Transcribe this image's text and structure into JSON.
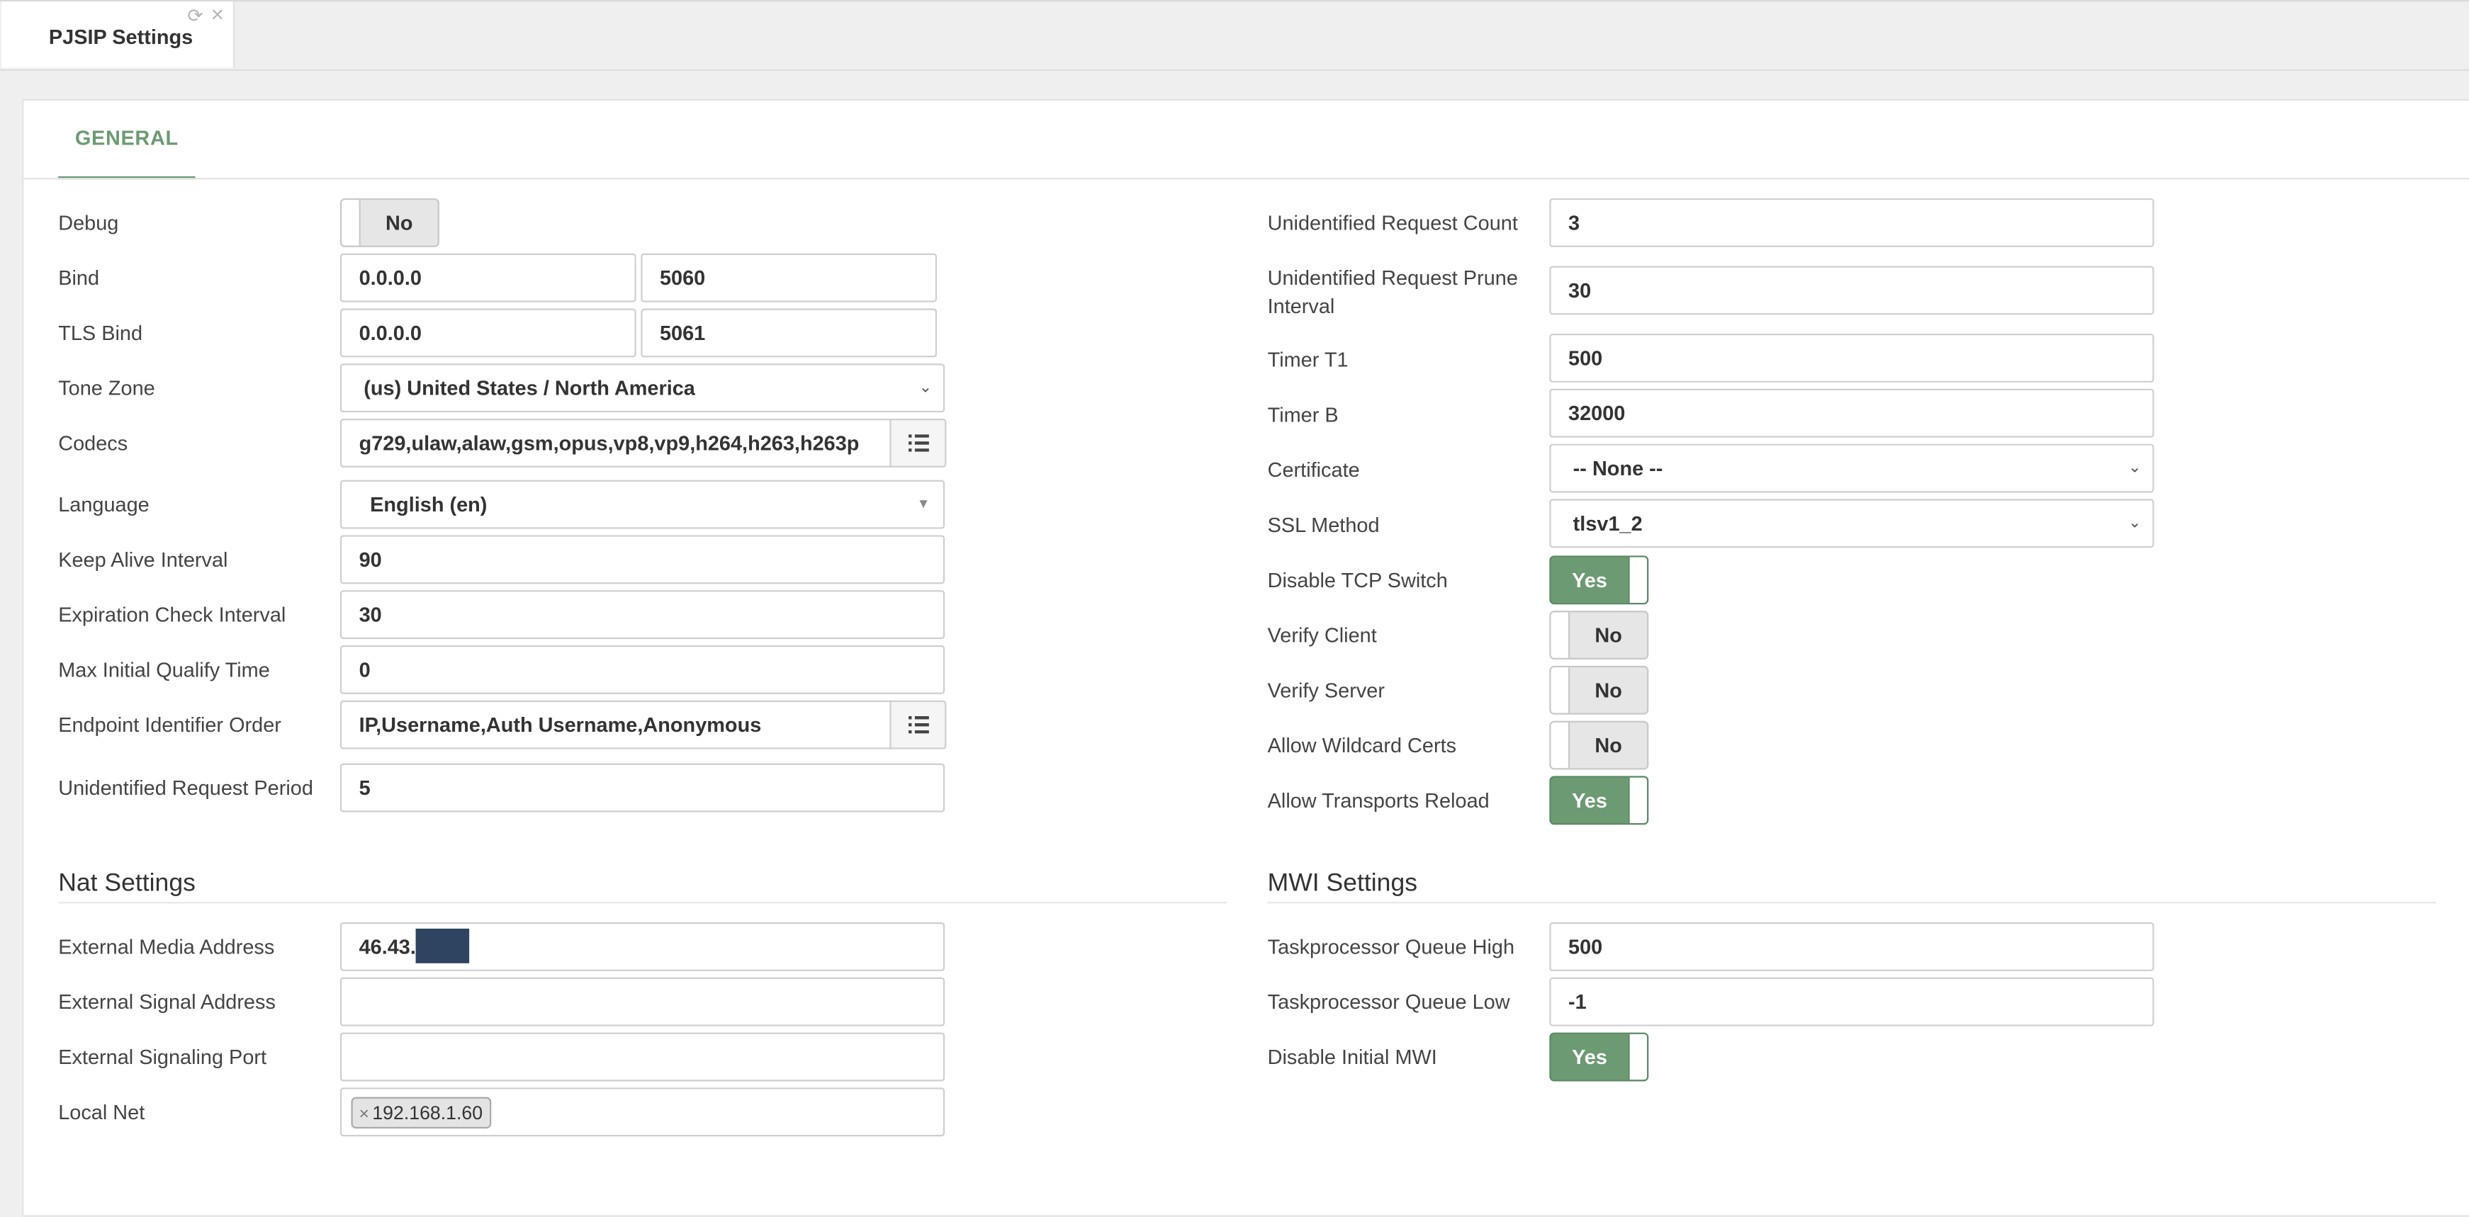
{
  "tab": {
    "title": "PJSIP Settings"
  },
  "panel_tab": "GENERAL",
  "left": {
    "debug_label": "Debug",
    "debug_value": "No",
    "bind_label": "Bind",
    "bind_ip": "0.0.0.0",
    "bind_port": "5060",
    "tls_bind_label": "TLS Bind",
    "tls_ip": "0.0.0.0",
    "tls_port": "5061",
    "tone_zone_label": "Tone Zone",
    "tone_zone_value": "(us) United States / North America",
    "codecs_label": "Codecs",
    "codecs_value": "g729,ulaw,alaw,gsm,opus,vp8,vp9,h264,h263,h263p",
    "language_label": "Language",
    "language_value": "English (en)",
    "keep_alive_label": "Keep Alive Interval",
    "keep_alive_value": "90",
    "expiration_label": "Expiration Check Interval",
    "expiration_value": "30",
    "max_qualify_label": "Max Initial Qualify Time",
    "max_qualify_value": "0",
    "endpoint_order_label": "Endpoint Identifier Order",
    "endpoint_order_value": "IP,Username,Auth Username,Anonymous",
    "unid_period_label": "Unidentified Request Period",
    "unid_period_value": "5"
  },
  "right": {
    "unid_count_label": "Unidentified Request Count",
    "unid_count_value": "3",
    "unid_prune_label_1": "Unidentified Request Prune",
    "unid_prune_label_2": "Interval",
    "unid_prune_value": "30",
    "timer_t1_label": "Timer T1",
    "timer_t1_value": "500",
    "timer_b_label": "Timer B",
    "timer_b_value": "32000",
    "certificate_label": "Certificate",
    "certificate_value": "-- None --",
    "ssl_label": "SSL Method",
    "ssl_value": "tlsv1_2",
    "disable_tcp_label": "Disable TCP Switch",
    "disable_tcp_value": "Yes",
    "verify_client_label": "Verify Client",
    "verify_client_value": "No",
    "verify_server_label": "Verify Server",
    "verify_server_value": "No",
    "wildcard_label": "Allow Wildcard Certs",
    "wildcard_value": "No",
    "transports_reload_label": "Allow Transports Reload",
    "transports_reload_value": "Yes"
  },
  "nat": {
    "title": "Nat Settings",
    "ext_media_label": "External Media Address",
    "ext_media_value": "46.43.",
    "ext_signal_label": "External Signal Address",
    "ext_signal_port_label": "External Signaling Port",
    "local_net_label": "Local Net",
    "local_net_chip": "192.168.1.60",
    "chip_remove": "×"
  },
  "mwi": {
    "title": "MWI Settings",
    "queue_high_label": "Taskprocessor Queue High",
    "queue_high_value": "500",
    "queue_low_label": "Taskprocessor Queue Low",
    "queue_low_value": "-1",
    "initial_mwi_label": "Disable Initial MWI",
    "initial_mwi_value": "Yes"
  },
  "icons": {
    "refresh": "refresh-icon",
    "close": "close-icon",
    "list": "list-icon",
    "caret": "chevron-down-icon"
  }
}
